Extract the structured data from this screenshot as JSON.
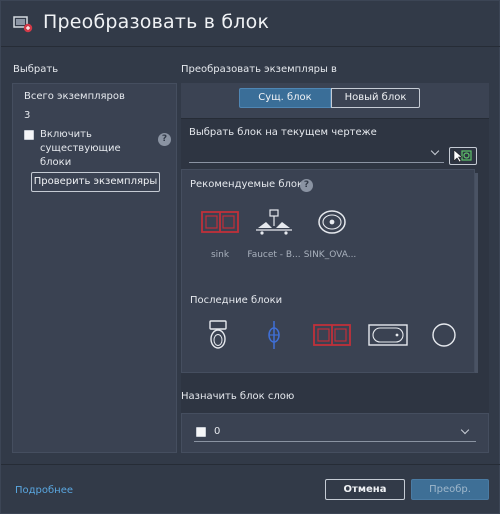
{
  "dialog": {
    "title": "Преобразовать в блок",
    "title_icon": "convert-to-block-icon"
  },
  "left": {
    "section_label": "Выбрать",
    "count_label": "Всего экземпляров",
    "count_value": "3",
    "include_checkbox": {
      "checked": false,
      "label": "Включить существующие блоки"
    },
    "help_icon": "?",
    "verify_button": "Проверить экземпляры"
  },
  "right": {
    "section_label": "Преобразовать экземпляры в",
    "tabs": [
      {
        "label": "Сущ. блок",
        "active": true
      },
      {
        "label": "Новый блок",
        "active": false
      }
    ],
    "select_label": "Выбрать блок на текущем чертеже",
    "select_value": "",
    "pick_button_icon": "pick-block-icon",
    "recommended_label": "Рекомендуемые блоки",
    "recommended_help_icon": "?",
    "recommended": [
      {
        "name": "sink",
        "icon": "sink-icon"
      },
      {
        "name": "Faucet - B...",
        "icon": "faucet-icon"
      },
      {
        "name": "SINK_OVA...",
        "icon": "oval-sink-icon"
      }
    ],
    "recent_label": "Последние блоки",
    "recent": [
      {
        "icon": "toilet-icon"
      },
      {
        "icon": "faucet-blue-icon"
      },
      {
        "icon": "sink-icon"
      },
      {
        "icon": "bathtub-icon"
      },
      {
        "icon": "circle-icon"
      }
    ],
    "assign_label": "Назначить блок слою",
    "layer": {
      "checked": false,
      "value": "0"
    }
  },
  "footer": {
    "more_link": "Подробнее",
    "cancel_button": "Отмена",
    "convert_button": "Преобр."
  },
  "colors": {
    "background": "#323a48",
    "panel": "#3a4252",
    "accent": "#3a6e98",
    "link": "#5aa7e0",
    "block_red": "#c0303a",
    "block_blue": "#3f6fd6"
  }
}
